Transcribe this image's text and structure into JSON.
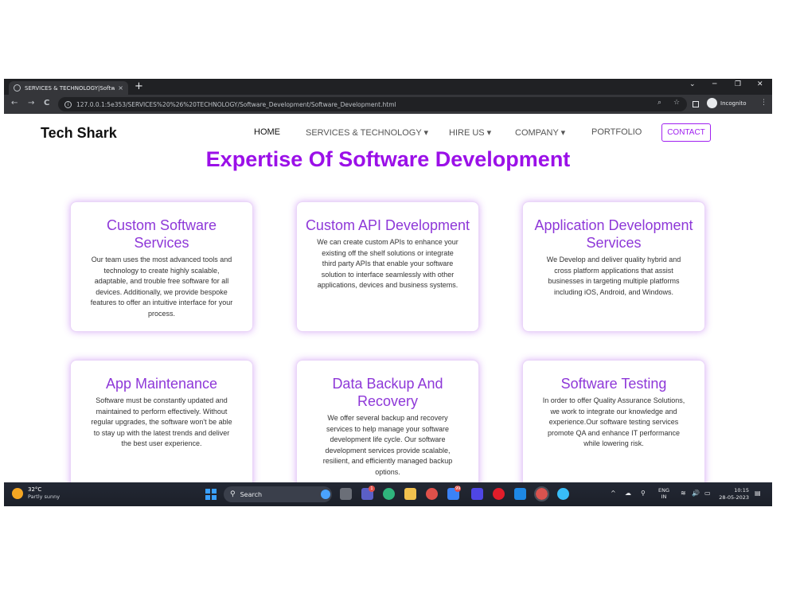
{
  "browser": {
    "tab_title": "SERVICES & TECHNOLOGY|Softw",
    "tab_close": "×",
    "new_tab": "+",
    "url": "127.0.0.1:5e353/SERVICES%20%26%20TECHNOLOGY/Software_Development/Software_Development.html",
    "profile_label": "Incognito",
    "back": "←",
    "forward": "→",
    "reload": "C",
    "zoom_glyph": "⌕",
    "star_glyph": "☆",
    "menu_glyph": "⋮",
    "minimize": "─",
    "maximize": "❐",
    "close": "✕",
    "chevron": "⌄"
  },
  "nav": {
    "brand": "Tech Shark",
    "links": [
      {
        "label": "HOME"
      },
      {
        "label": "SERVICES & TECHNOLOGY ▾"
      },
      {
        "label": "HIRE US ▾"
      },
      {
        "label": "COMPANY ▾"
      },
      {
        "label": "PORTFOLIO"
      }
    ],
    "contact": "CONTACT"
  },
  "main": {
    "heading": "Expertise Of Software Development",
    "cards": [
      {
        "title": "Custom Software Services",
        "text": "Our team uses the most advanced tools and technology to create highly scalable, adaptable, and trouble free software for all devices. Additionally, we provide bespoke features to offer an intuitive interface for your process."
      },
      {
        "title": "Custom API Development",
        "text": "We can create custom APIs to enhance your existing off the shelf solutions or integrate third party APIs that enable your software solution to interface seamlessly with other applications, devices and business systems."
      },
      {
        "title": "Application Development Services",
        "text": "We Develop and deliver quality hybrid and cross platform applications that assist businesses in targeting multiple platforms including iOS, Android, and Windows."
      },
      {
        "title": "App Maintenance",
        "text": "Software must be constantly updated and maintained to perform effectively. Without regular upgrades, the software won't be able to stay up with the latest trends and deliver the best user experience."
      },
      {
        "title": "Data Backup And Recovery",
        "text": "We offer several backup and recovery services to help manage your software development life cycle. Our software development services provide scalable, resilient, and efficiently managed backup options."
      },
      {
        "title": "Software Testing",
        "text": "In order to offer Quality Assurance Solutions, we work to integrate our knowledge and experience.Our software testing services promote QA and enhance IT performance while lowering risk."
      }
    ]
  },
  "taskbar": {
    "temperature": "32°C",
    "weather": "Partly sunny",
    "search_placeholder": "Search",
    "badges": [
      "1",
      "99"
    ],
    "lang_top": "ENG",
    "lang_bottom": "IN",
    "time": "10:15",
    "date": "28-05-2023",
    "tray_up": "^",
    "tray_speaker": "🔊"
  },
  "colors": {
    "accent": "#9b10e8",
    "card_title": "#8e38d8",
    "chrome_dark": "#202124"
  },
  "icons": [
    "globe-icon",
    "info-icon",
    "zoom-icon",
    "star-icon",
    "sidepanel-icon",
    "incognito-icon",
    "menu-icon",
    "windows-icon",
    "search-icon",
    "wifi-icon",
    "speaker-icon",
    "battery-icon",
    "notification-icon"
  ]
}
